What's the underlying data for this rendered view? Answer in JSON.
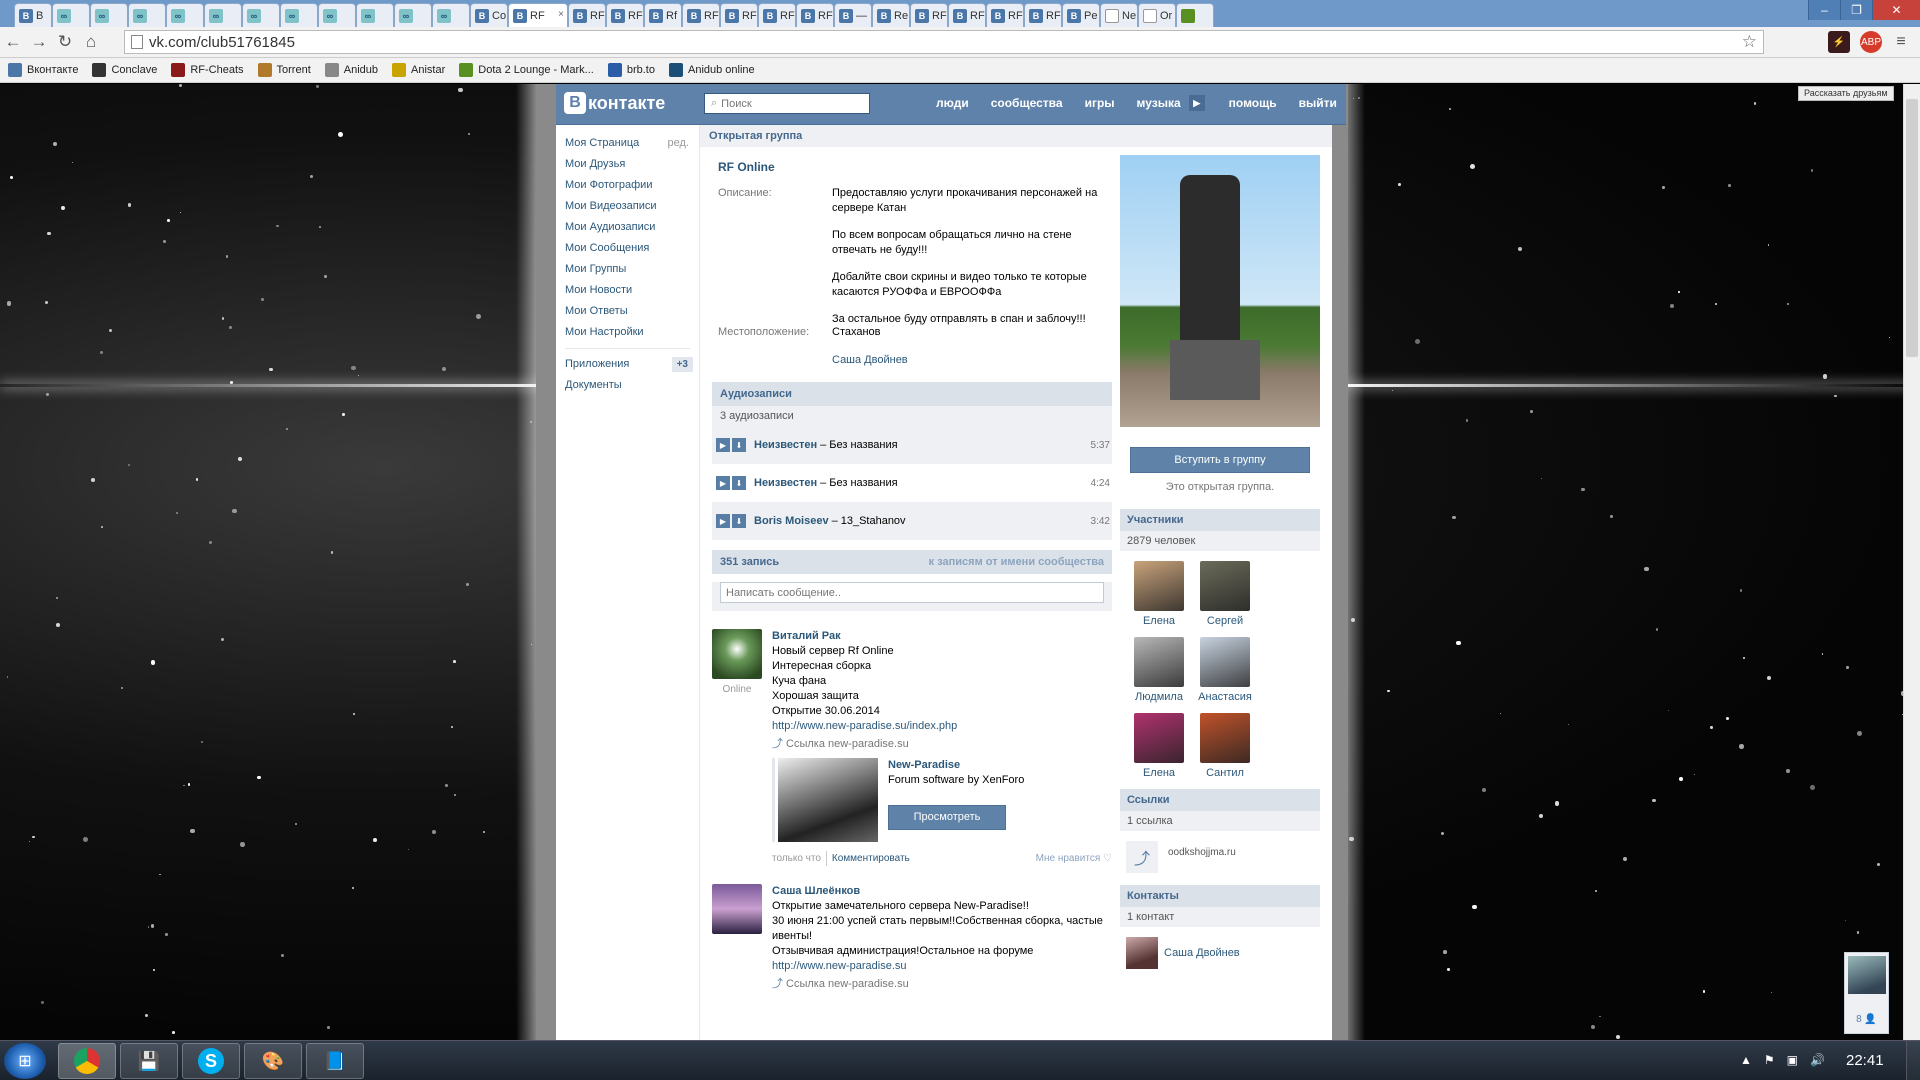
{
  "browser": {
    "tabs": [
      {
        "icon": "vk-icon",
        "label": "В"
      },
      {
        "icon": "glasses-icon",
        "label": ""
      },
      {
        "icon": "glasses-icon",
        "label": ""
      },
      {
        "icon": "glasses-icon",
        "label": ""
      },
      {
        "icon": "glasses-icon",
        "label": ""
      },
      {
        "icon": "glasses-icon",
        "label": ""
      },
      {
        "icon": "glasses-icon",
        "label": ""
      },
      {
        "icon": "glasses-icon",
        "label": ""
      },
      {
        "icon": "glasses-icon",
        "label": ""
      },
      {
        "icon": "glasses-icon",
        "label": ""
      },
      {
        "icon": "glasses-icon",
        "label": ""
      },
      {
        "icon": "glasses-icon",
        "label": ""
      },
      {
        "icon": "vk-icon",
        "label": "Co"
      },
      {
        "icon": "vk-icon",
        "label": "RF",
        "active": true
      },
      {
        "icon": "vk-icon",
        "label": "RF"
      },
      {
        "icon": "vk-icon",
        "label": "RF"
      },
      {
        "icon": "vk-icon",
        "label": "Rf"
      },
      {
        "icon": "vk-icon",
        "label": "RF"
      },
      {
        "icon": "vk-icon",
        "label": "RF"
      },
      {
        "icon": "vk-icon",
        "label": "RF"
      },
      {
        "icon": "vk-icon",
        "label": "RF"
      },
      {
        "icon": "vk-icon",
        "label": "—"
      },
      {
        "icon": "vk-icon",
        "label": "Re"
      },
      {
        "icon": "vk-icon",
        "label": "RF"
      },
      {
        "icon": "vk-icon",
        "label": "RF"
      },
      {
        "icon": "vk-icon",
        "label": "RF"
      },
      {
        "icon": "vk-icon",
        "label": "RF"
      },
      {
        "icon": "vk-icon",
        "label": "Pe"
      },
      {
        "icon": "page-icon",
        "label": "Ne"
      },
      {
        "icon": "page-icon",
        "label": "Or"
      },
      {
        "icon": "dota-icon",
        "label": ""
      }
    ],
    "url": "vk.com/club51761845",
    "bookmarks": [
      {
        "icon": "vk-icon",
        "label": "Вконтакте",
        "color": "#4b77a8"
      },
      {
        "icon": "shield-icon",
        "label": "Conclave",
        "color": "#333333"
      },
      {
        "icon": "rf-icon",
        "label": "RF-Cheats",
        "color": "#8a1a1a"
      },
      {
        "icon": "torrent-icon",
        "label": "Torrent",
        "color": "#b07a2a"
      },
      {
        "icon": "anidub-icon",
        "label": "Anidub",
        "color": "#888888"
      },
      {
        "icon": "star-icon",
        "label": "Anistar",
        "color": "#c9a400"
      },
      {
        "icon": "dota-icon",
        "label": "Dota 2 Lounge - Mark...",
        "color": "#5a8f21"
      },
      {
        "icon": "brb-icon",
        "label": "brb.to",
        "color": "#2a5ca8"
      },
      {
        "icon": "glasses-icon",
        "label": "Anidub online",
        "color": "#1b4f77"
      }
    ],
    "share_tooltip": "Рассказать друзьям"
  },
  "vk": {
    "logo_text": "контакте",
    "search_placeholder": "Поиск",
    "nav": [
      "люди",
      "сообщества",
      "игры",
      "музыка",
      "помощь",
      "выйти"
    ],
    "left_menu": [
      {
        "label": "Моя Страница",
        "extra": "ред."
      },
      {
        "label": "Мои Друзья"
      },
      {
        "label": "Мои Фотографии"
      },
      {
        "label": "Мои Видеозаписи"
      },
      {
        "label": "Мои Аудиозаписи"
      },
      {
        "label": "Мои Сообщения"
      },
      {
        "label": "Мои Группы"
      },
      {
        "label": "Мои Новости"
      },
      {
        "label": "Мои Ответы"
      },
      {
        "label": "Мои Настройки"
      }
    ],
    "left_menu_2": [
      {
        "label": "Приложения",
        "badge": "+3"
      },
      {
        "label": "Документы"
      }
    ],
    "page_header": "Открытая группа",
    "group_name": "RF Online",
    "info": {
      "desc_label": "Описание:",
      "desc_paragraphs": [
        "Предоставляю услуги прокачивания персонажей на сервере Катан",
        "По всем вопросам обращаться лично на стене отвечать не буду!!!",
        "Добалйте свои скрины и видео только те которые касаются РУОФФа и ЕВРООФФа",
        "За остальное буду отправлять в спан и заблочу!!!"
      ],
      "loc_label": "Местоположение:",
      "loc_value": "Стаханов",
      "contact_link": "Саша Двойнев"
    },
    "audio": {
      "title": "Аудиозаписи",
      "count": "3 аудиозаписи",
      "tracks": [
        {
          "artist": "Неизвестен",
          "title": "Без названия",
          "duration": "5:37"
        },
        {
          "artist": "Неизвестен",
          "title": "Без названия",
          "duration": "4:24"
        },
        {
          "artist": "Boris Moiseev",
          "title": "13_Stahanov",
          "duration": "3:42"
        }
      ]
    },
    "wall": {
      "count": "351 запись",
      "filter": "к записям от имени сообщества",
      "input_placeholder": "Написать сообщение..",
      "posts": [
        {
          "author": "Виталий Рак",
          "status": "Online",
          "lines": [
            "Новый сервер Rf Online",
            "Интересная сборка",
            "Куча фана",
            "Хорошая защита",
            "Открытие 30.06.2014"
          ],
          "link": "http://www.new-paradise.su/index.php",
          "link_caption": "Ссылка new-paradise.su",
          "card_title": "New-Paradise",
          "card_desc": "Forum software by XenForo",
          "card_button": "Просмотреть",
          "meta_time": "только что",
          "meta_comment": "Комментировать",
          "meta_like": "Мне нравится ♡"
        },
        {
          "author": "Саша Шлеёнков",
          "lines": [
            "Открытие замечательного сервера New-Paradise!!",
            "30 июня 21:00 успей стать первым!!Собственная сборка, частые ивенты!",
            "Отзывчивая администрация!Остальное на форуме"
          ],
          "link": "http://www.new-paradise.su",
          "link_caption": "Ссылка new-paradise.su"
        }
      ]
    },
    "side": {
      "join_button": "Вступить в группу",
      "open_note": "Это открытая группа.",
      "members_title": "Участники",
      "members_count": "2879 человек",
      "members": [
        {
          "name": "Елена",
          "color": "#c9a37b"
        },
        {
          "name": "Сергей",
          "color": "#6b6b5a"
        },
        {
          "name": "Людмила",
          "color": "#b8b8b8"
        },
        {
          "name": "Анастасия",
          "color": "#c8d3e0"
        },
        {
          "name": "Елена",
          "color": "#b0326e"
        },
        {
          "name": "Сантил",
          "color": "#c0522a"
        }
      ],
      "links_title": "Ссылки",
      "links_count": "1 ссылка",
      "link_text": "oodkshojjma.ru",
      "contacts_title": "Контакты",
      "contacts_count": "1 контакт",
      "contact_name": "Саша Двойнев"
    },
    "chat_count": "8 👤"
  },
  "taskbar": {
    "apps": [
      "chrome-icon",
      "floppy-icon",
      "skype-icon",
      "paint-icon",
      "notes-icon"
    ],
    "clock": "22:41"
  }
}
